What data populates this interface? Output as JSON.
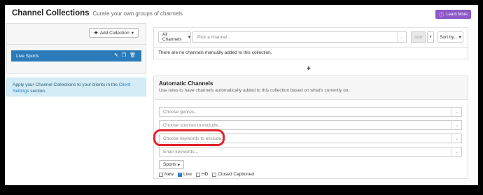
{
  "header": {
    "title": "Channel Collections",
    "subtitle": "Curate your own groups of channels",
    "learn_more": "Learn More",
    "learn_more_icon": "info-icon"
  },
  "left": {
    "add_collection": "Add Collection",
    "collection_name": "Live Sports",
    "info_text": "Apply your Channel Collections to your clients in the ",
    "info_link": "Client Settings",
    "info_suffix": " section."
  },
  "manual": {
    "all_channels": "All Channels",
    "pick_placeholder": "Pick a channel...",
    "add_label": "Add",
    "sort_label": "Sort by...",
    "empty_text": "There are no channels manually added to this collection."
  },
  "plus_label": "+",
  "automatic": {
    "title": "Automatic Channels",
    "description": "Use rules to have channels automatically added to this collection based on what's currently on.",
    "genres_placeholder": "Choose genres...",
    "sources_placeholder": "Choose sources to exclude...",
    "keywords_exclude_placeholder": "Choose keywords to exclude...",
    "keywords_placeholder": "Enter keywords...",
    "sports_label": "Sports",
    "checkboxes": [
      {
        "label": "New",
        "checked": false
      },
      {
        "label": "Live",
        "checked": true
      },
      {
        "label": "HD",
        "checked": false
      },
      {
        "label": "Closed Captioned",
        "checked": false
      }
    ]
  },
  "colors": {
    "accent_blue": "#2b7bbb",
    "learn_more_purple": "#8e58c9",
    "highlight_red": "#e4222b",
    "info_bg": "#d4ecf6"
  }
}
